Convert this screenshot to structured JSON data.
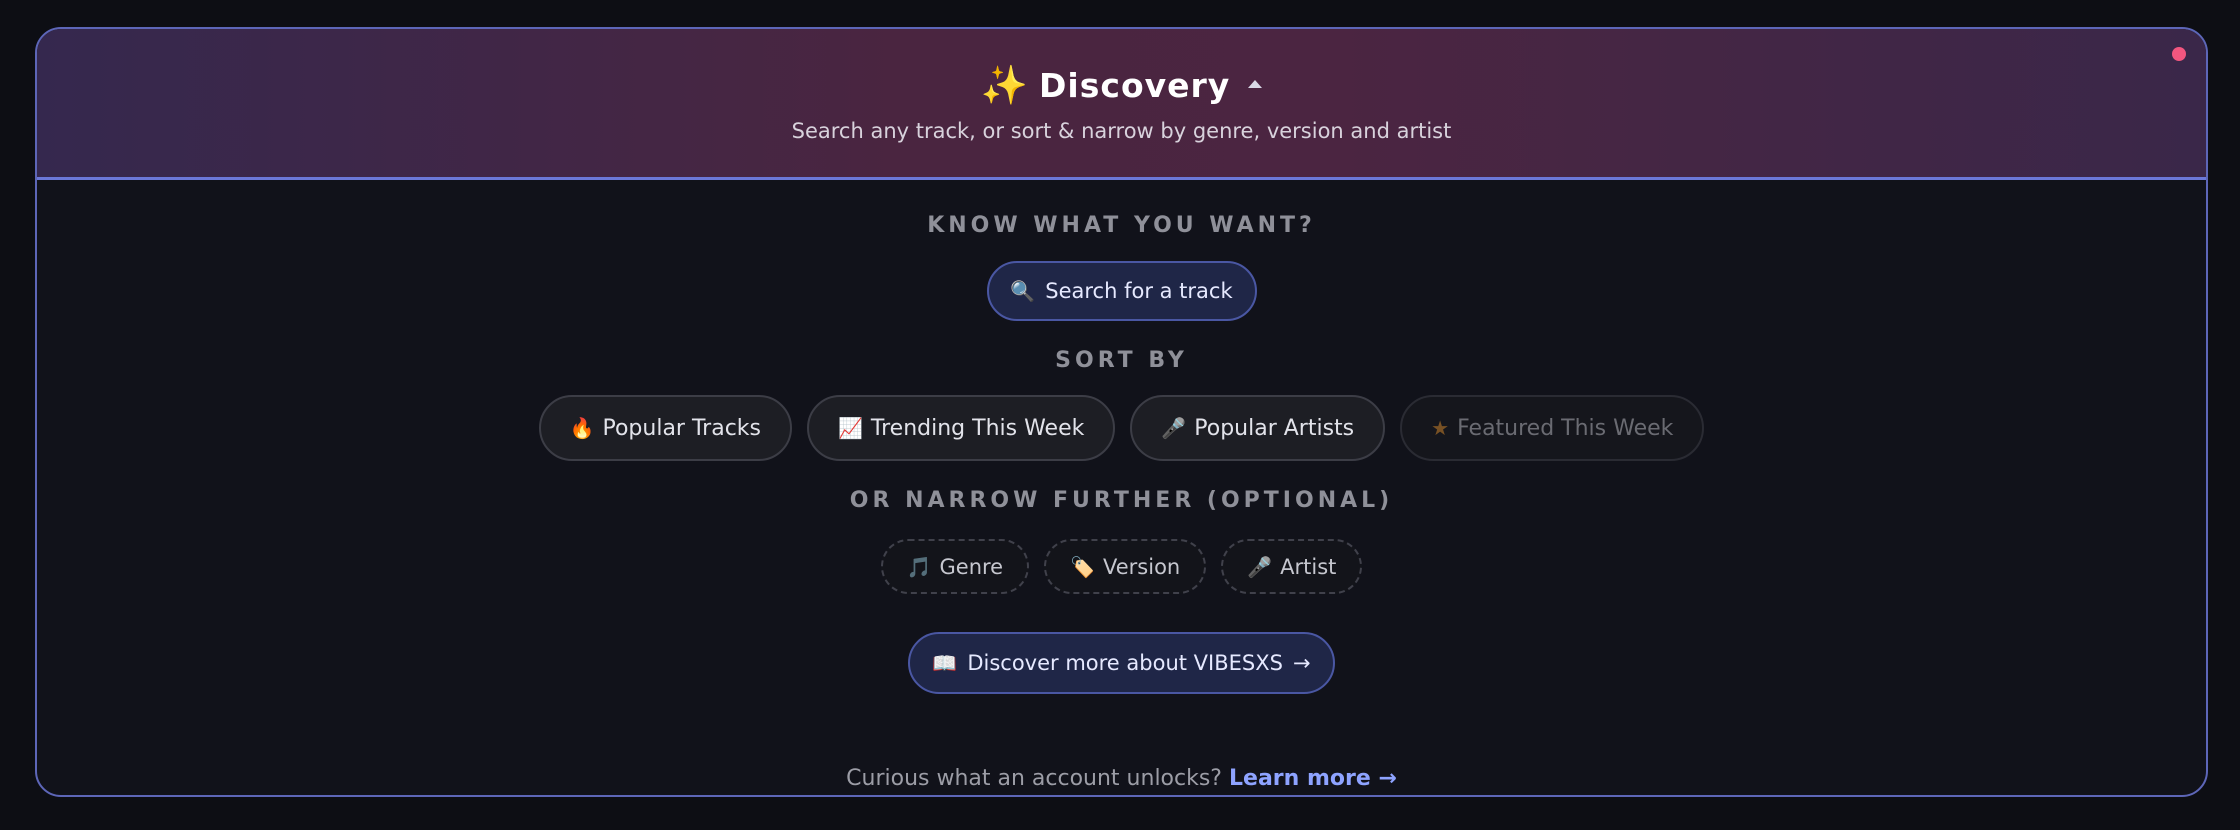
{
  "header": {
    "icon": "✨",
    "title": "Discovery",
    "subtitle": "Search any track, or sort & narrow by genre, version and artist",
    "status_dot_color": "#f2567f"
  },
  "search_section": {
    "label": "KNOW WHAT YOU WANT?",
    "button_icon": "🔍",
    "button_label": "Search for a track"
  },
  "sort_section": {
    "label": "SORT BY",
    "options": [
      {
        "icon": "🔥",
        "label": "Popular Tracks",
        "state": "enabled"
      },
      {
        "icon": "📈",
        "label": "Trending This Week",
        "state": "enabled"
      },
      {
        "icon": "🎤",
        "label": "Popular Artists",
        "state": "enabled"
      },
      {
        "icon": "★",
        "label": "Featured This Week",
        "state": "disabled"
      }
    ]
  },
  "narrow_section": {
    "label": "OR NARROW FURTHER (OPTIONAL)",
    "filters": [
      {
        "icon": "🎵",
        "label": "Genre"
      },
      {
        "icon": "🏷️",
        "label": "Version"
      },
      {
        "icon": "🎤",
        "label": "Artist"
      }
    ]
  },
  "discover_button": {
    "icon": "📖",
    "label": "Discover more about VIBESXS",
    "arrow": "→"
  },
  "footer": {
    "text": "Curious what an account unlocks?",
    "link": "Learn more →"
  },
  "colors": {
    "accent": "#6b78d8",
    "link": "#8ea3ff",
    "background": "#11121a"
  }
}
